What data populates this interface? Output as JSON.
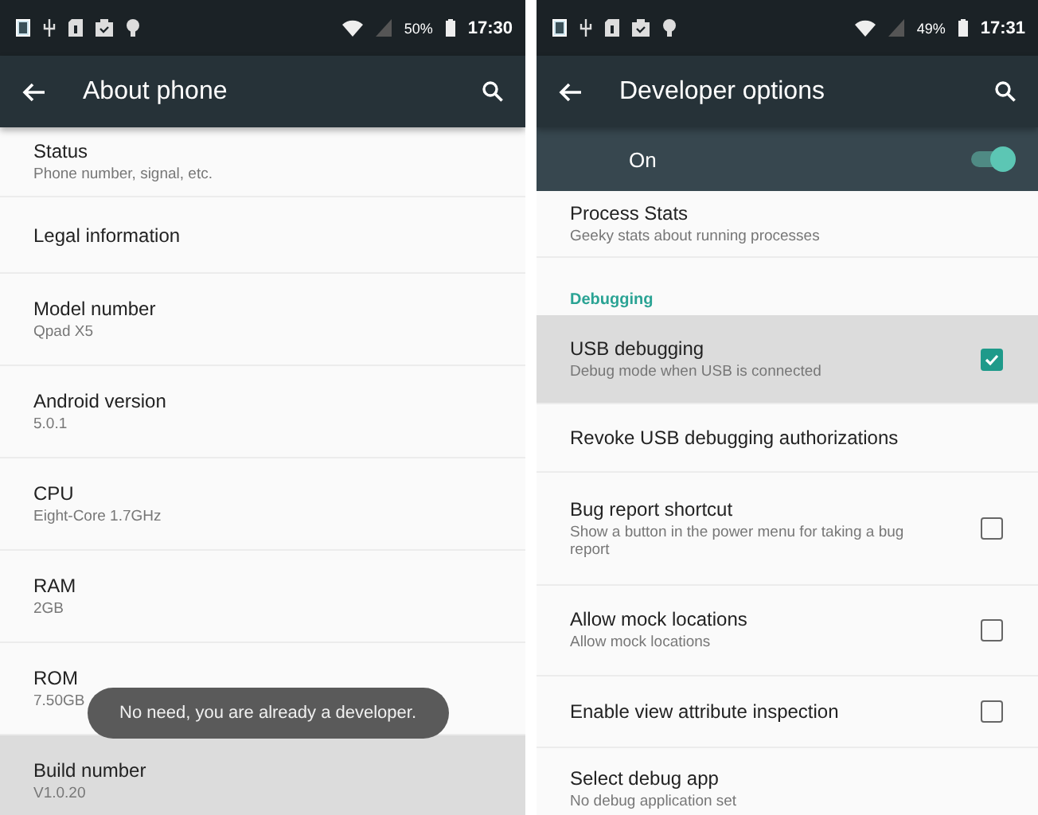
{
  "screens": [
    {
      "status_bar": {
        "battery": "50%",
        "time": "17:30"
      },
      "app_bar": {
        "title": "About phone"
      },
      "items": [
        {
          "kind": "setting",
          "title": "Status",
          "summary": "Phone number, signal, etc.",
          "pressed": false
        },
        {
          "kind": "setting",
          "title": "Legal information",
          "pressed": false
        },
        {
          "kind": "setting",
          "title": "Model number",
          "summary": "Qpad X5",
          "pressed": false
        },
        {
          "kind": "setting",
          "title": "Android version",
          "summary": "5.0.1",
          "pressed": false
        },
        {
          "kind": "setting",
          "title": "CPU",
          "summary": "Eight-Core 1.7GHz",
          "pressed": false
        },
        {
          "kind": "setting",
          "title": "RAM",
          "summary": "2GB",
          "pressed": false
        },
        {
          "kind": "setting",
          "title": "ROM",
          "summary": "7.50GB",
          "pressed": false
        },
        {
          "kind": "setting",
          "title": "Build number",
          "summary": "V1.0.20",
          "pressed": true
        }
      ],
      "toast": {
        "text": "No need, you are already a developer."
      }
    },
    {
      "status_bar": {
        "battery": "49%",
        "time": "17:31"
      },
      "app_bar": {
        "title": "Developer options"
      },
      "master_switch": {
        "label": "On",
        "on": true
      },
      "items": [
        {
          "kind": "setting",
          "title": "Process Stats",
          "summary": "Geeky stats about running processes",
          "pressed": false
        },
        {
          "kind": "header",
          "title": "Debugging"
        },
        {
          "kind": "checkbox",
          "title": "USB debugging",
          "summary": "Debug mode when USB is connected",
          "checked": true,
          "pressed": true
        },
        {
          "kind": "setting",
          "title": "Revoke USB debugging authorizations",
          "pressed": false
        },
        {
          "kind": "checkbox",
          "title": "Bug report shortcut",
          "summary": "Show a button in the power menu for taking a bug report",
          "checked": false,
          "pressed": false
        },
        {
          "kind": "checkbox",
          "title": "Allow mock locations",
          "summary": "Allow mock locations",
          "checked": false,
          "pressed": false
        },
        {
          "kind": "checkbox",
          "title": "Enable view attribute inspection",
          "checked": false,
          "pressed": false
        },
        {
          "kind": "setting",
          "title": "Select debug app",
          "summary": "No debug application set",
          "pressed": false
        }
      ]
    }
  ]
}
